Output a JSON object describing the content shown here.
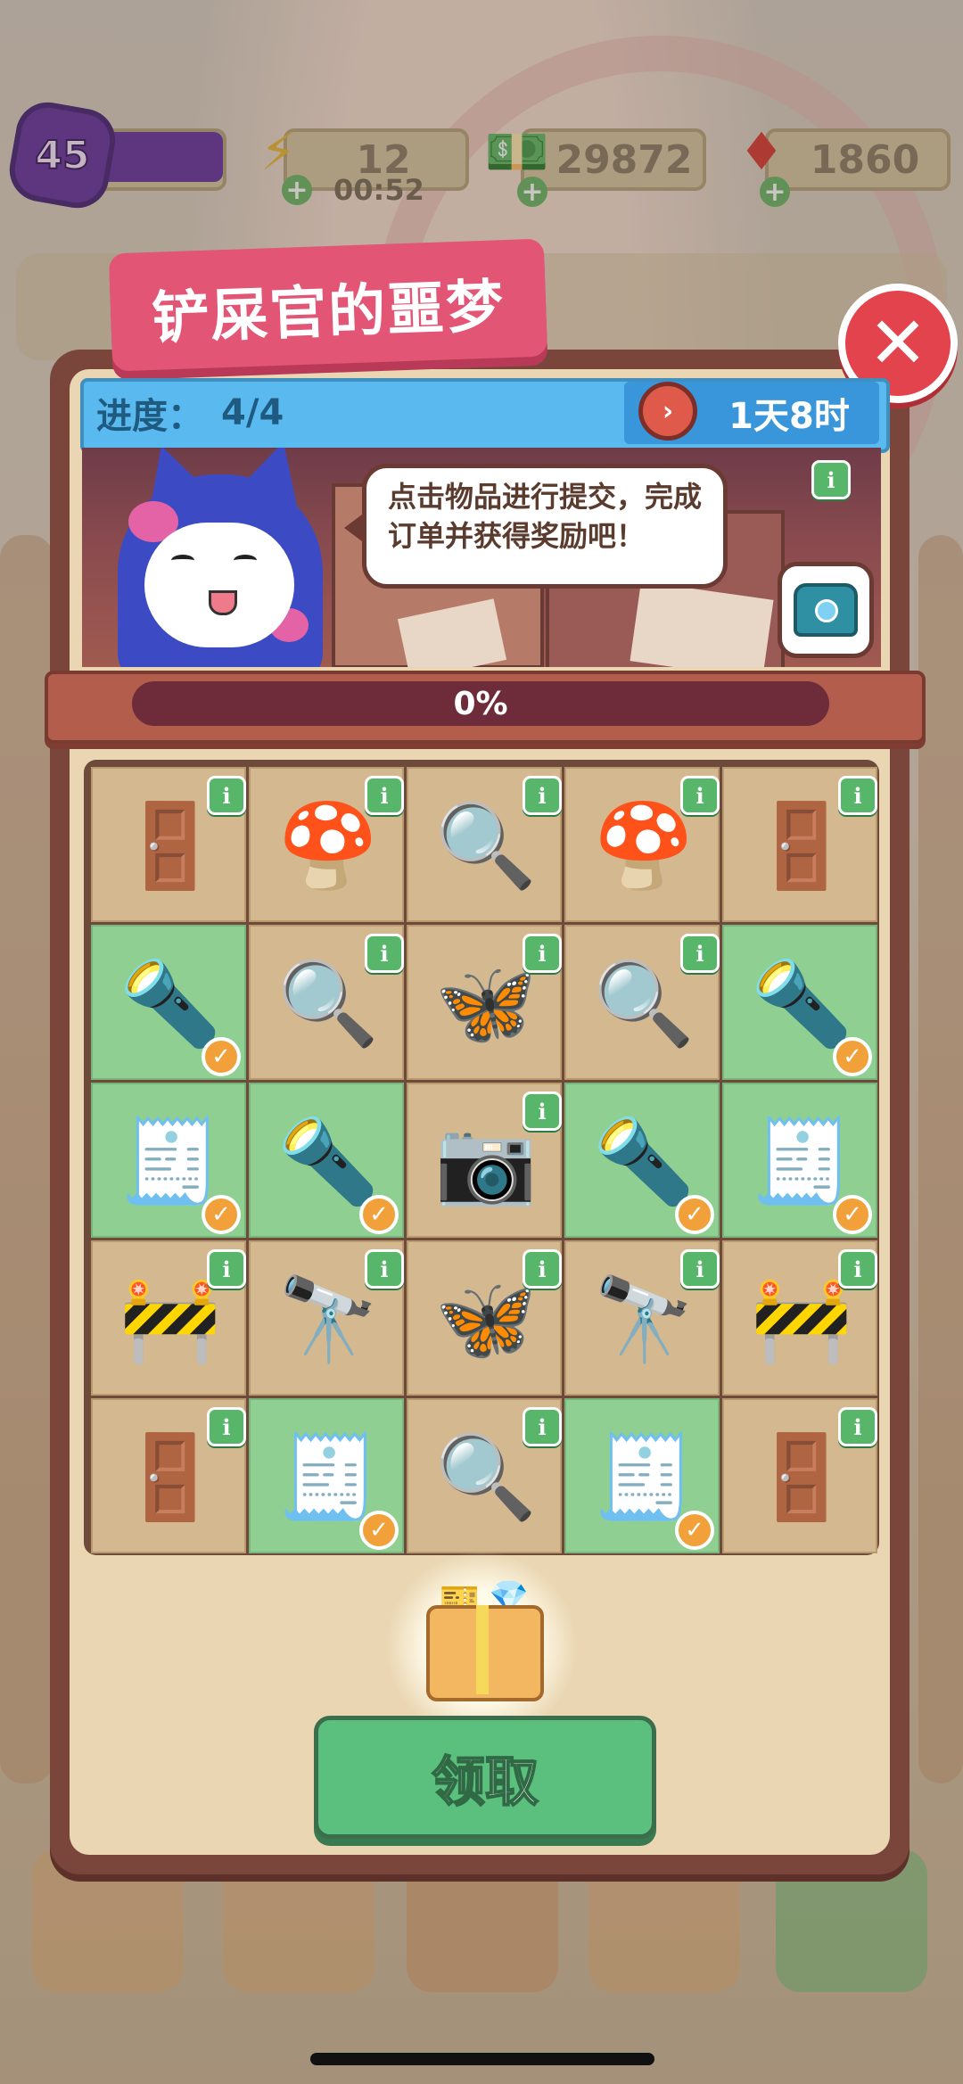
{
  "hud": {
    "level": "45",
    "energy": "12",
    "energy_timer": "00:52",
    "cash": "29872",
    "gems": "1860"
  },
  "dialog": {
    "title": "铲屎官的噩梦",
    "progress_label": "进度：",
    "progress_value": "4/4",
    "time_left": "1天8时",
    "speech": "点击物品进行提交，完成订单并获得奖励吧！",
    "progress_percent_text": "0%",
    "progress_fraction": 0,
    "claim_label": "领取"
  },
  "grid": [
    [
      {
        "item": "door-handle-alarm",
        "glyph": "🚪",
        "done": false,
        "info": true
      },
      {
        "item": "mushroom-cluster",
        "glyph": "🍄",
        "done": false,
        "info": true
      },
      {
        "item": "magnifying-glass",
        "glyph": "🔍",
        "done": false,
        "info": true
      },
      {
        "item": "mushroom-cluster",
        "glyph": "🍄",
        "done": false,
        "info": true
      },
      {
        "item": "door-handle-alarm",
        "glyph": "🚪",
        "done": false,
        "info": true
      }
    ],
    [
      {
        "item": "flashlight",
        "glyph": "🔦",
        "done": true,
        "info": false
      },
      {
        "item": "magnifying-glass",
        "glyph": "🔍",
        "done": false,
        "info": true
      },
      {
        "item": "moth",
        "glyph": "🦋",
        "done": false,
        "info": true
      },
      {
        "item": "magnifying-glass",
        "glyph": "🔍",
        "done": false,
        "info": true
      },
      {
        "item": "flashlight",
        "glyph": "🔦",
        "done": true,
        "info": false
      }
    ],
    [
      {
        "item": "evidence-bag",
        "glyph": "🧾",
        "done": true,
        "info": false
      },
      {
        "item": "flashlight",
        "glyph": "🔦",
        "done": true,
        "info": false
      },
      {
        "item": "camera",
        "glyph": "📷",
        "done": false,
        "info": true
      },
      {
        "item": "flashlight",
        "glyph": "🔦",
        "done": true,
        "info": false
      },
      {
        "item": "evidence-bag",
        "glyph": "🧾",
        "done": true,
        "info": false
      }
    ],
    [
      {
        "item": "road-barrier",
        "glyph": "🚧",
        "done": false,
        "info": true
      },
      {
        "item": "binoculars",
        "glyph": "🔭",
        "done": false,
        "info": true
      },
      {
        "item": "moth",
        "glyph": "🦋",
        "done": false,
        "info": true
      },
      {
        "item": "binoculars",
        "glyph": "🔭",
        "done": false,
        "info": true
      },
      {
        "item": "road-barrier",
        "glyph": "🚧",
        "done": false,
        "info": true
      }
    ],
    [
      {
        "item": "door-handle-alarm",
        "glyph": "🚪",
        "done": false,
        "info": true
      },
      {
        "item": "evidence-bag",
        "glyph": "🧾",
        "done": true,
        "info": false
      },
      {
        "item": "magnifying-glass",
        "glyph": "🔍",
        "done": false,
        "info": true
      },
      {
        "item": "evidence-bag",
        "glyph": "🧾",
        "done": true,
        "info": false
      },
      {
        "item": "door-handle-alarm",
        "glyph": "🚪",
        "done": false,
        "info": true
      }
    ]
  ],
  "icons": {
    "info": "i",
    "check": "✓",
    "close": "✕",
    "energy": "⚡",
    "cash": "💵",
    "gem": "♦"
  },
  "colors": {
    "title_tag": "#e35575",
    "header_stripe": "#5ab9ef",
    "done_cell": "#8fcf92",
    "claim_button": "#5bbf7e",
    "close_button": "#e2434c"
  }
}
